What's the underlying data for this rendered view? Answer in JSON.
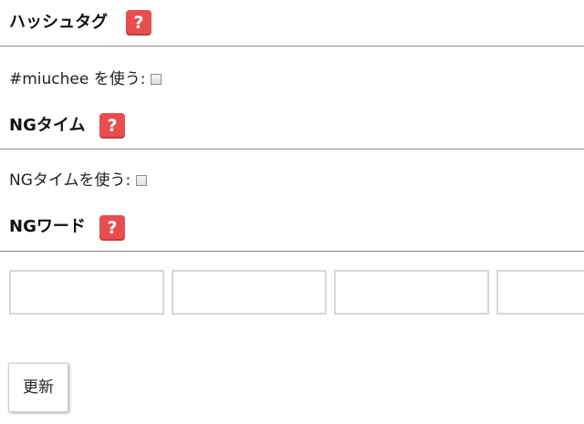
{
  "sections": {
    "hashtag": {
      "title": "ハッシュタグ",
      "help_icon": "?",
      "option_label": "#miuchee を使う:",
      "checked": false
    },
    "ng_time": {
      "title": "NGタイム",
      "help_icon": "?",
      "option_label": "NGタイムを使う:",
      "checked": false
    },
    "ng_word": {
      "title": "NGワード",
      "help_icon": "?",
      "inputs": [
        "",
        "",
        "",
        ""
      ]
    }
  },
  "update_button_label": "更新",
  "colors": {
    "help_icon_bg": "#e84e4e",
    "divider": "#8a8a8a"
  }
}
